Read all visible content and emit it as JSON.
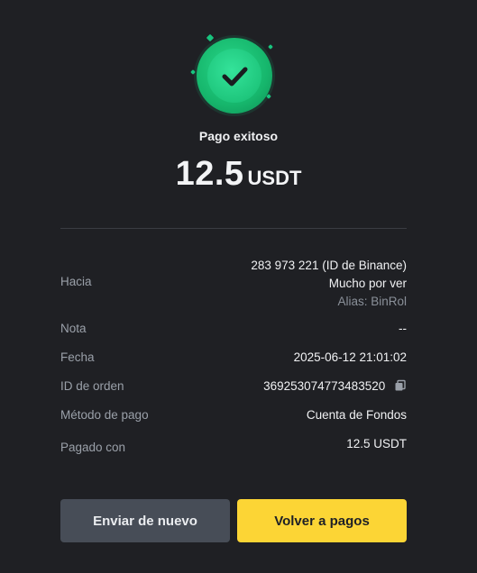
{
  "status": {
    "title": "Pago exitoso",
    "amount": "12.5",
    "unit": "USDT"
  },
  "details": {
    "to": {
      "label": "Hacia",
      "id_line": "283 973 221 (ID de Binance)",
      "name": "Mucho por ver",
      "alias": "Alias: BinRol"
    },
    "note": {
      "label": "Nota",
      "value": "--"
    },
    "date": {
      "label": "Fecha",
      "value": "2025-06-12 21:01:02"
    },
    "order_id": {
      "label": "ID de orden",
      "value": "369253074773483520"
    },
    "payment_method": {
      "label": "Método de pago",
      "value": "Cuenta de Fondos"
    },
    "paid_with": {
      "label": "Pagado con",
      "value": "12.5 USDT"
    }
  },
  "actions": {
    "send_again": "Enviar de nuevo",
    "back_to_payments": "Volver a pagos"
  },
  "colors": {
    "background": "#1f2024",
    "success": "#1fc77d",
    "primary_button": "#fcd535",
    "secondary_button": "#474d57"
  },
  "icons": {
    "success": "check-circle-icon",
    "copy": "copy-icon"
  }
}
